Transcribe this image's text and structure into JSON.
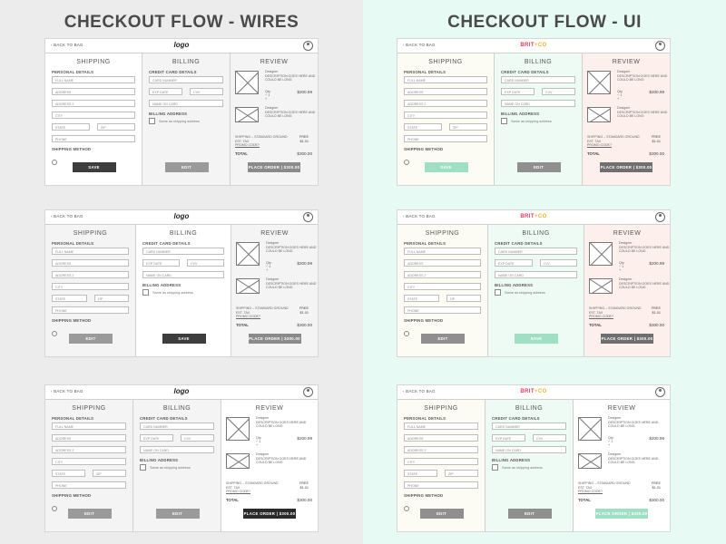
{
  "titles": {
    "wires": "CHECKOUT FLOW - WIRES",
    "ui": "CHECKOUT FLOW - UI"
  },
  "header": {
    "back": "BACK TO BAG",
    "logo_wire": "logo",
    "logo_ui": "BRIT+CO"
  },
  "colors": {
    "wire_dark": "#3d3d3d",
    "wire_btn": "#9a9a9a",
    "mint": "#9fe0c4",
    "ui_btn": "#8f8f8f",
    "ui_dark": "#6f6f6f",
    "ship_ui": "#fcfcf4",
    "bill_ui": "#eefbf5",
    "review_ui": "#fdf0ec",
    "bg_left": "#ececec",
    "bg_right": "#e7fbf4",
    "logo_brit": "#e23a5c",
    "logo_co": "#f3b52d"
  },
  "sections": {
    "shipping": "SHIPPING",
    "billing": "BILLING",
    "review": "REVIEW"
  },
  "shipping": {
    "personal_details": "PERSONAL DETAILS",
    "full_name": "FULL NAME",
    "address": "ADDRESS",
    "address2": "ADDRESS 2",
    "city": "CITY",
    "state": "STATE",
    "zip": "ZIP",
    "phone": "PHONE",
    "shipping_method": "SHIPPING METHOD"
  },
  "billing": {
    "credit_card_details": "CREDIT CARD DETAILS",
    "card_number": "CARD NUMBER",
    "exp_date": "EXP DATE",
    "cvv": "CVV",
    "name_on_card": "NAME ON CARD",
    "billing_address": "BILLING ADDRESS",
    "same_as_shipping": "Same as shipping address"
  },
  "review": {
    "designer": "Designer",
    "description": "DESCRIPTION GOES HERE AND COULD BE LONG",
    "qty": "Qty",
    "qty_value": "1",
    "minus": "−",
    "plus": "+",
    "price": "$200.99",
    "shipping_line": "SHIPPING – STANDARD GROUND",
    "free": "FREE",
    "est_tax": "EST. TAX",
    "tax": "$1.01",
    "promo": "PROMO CODE?",
    "total_label": "TOTAL",
    "total": "$300.00",
    "place_order": "PLACE ORDER  |  $300.00"
  },
  "buttons": {
    "save": "SAVE",
    "edit": "EDIT"
  }
}
